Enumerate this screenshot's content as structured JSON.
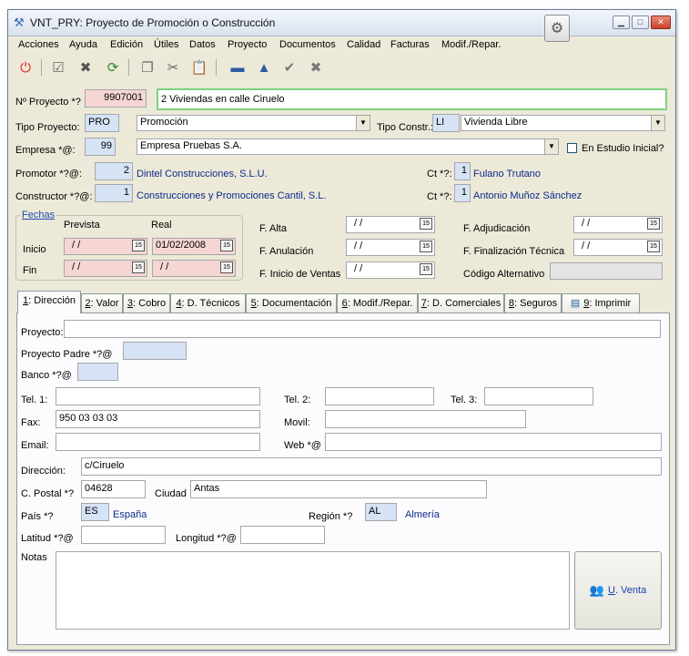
{
  "window": {
    "title": "VNT_PRY: Proyecto de Promoción o Construcción"
  },
  "menu": [
    "Acciones",
    "Ayuda",
    "Edición",
    "Útiles",
    "Datos",
    "Proyecto",
    "Documentos",
    "Calidad",
    "Facturas",
    "Modif./Repar."
  ],
  "header": {
    "nproyecto_label": "Nº Proyecto *?",
    "nproyecto_value": "9907001",
    "nombre_value": "2 Viviendas en calle Ciruelo",
    "tipo_proyecto_label": "Tipo Proyecto:",
    "tipo_proyecto_code": "PRO",
    "tipo_proyecto_desc": "Promoción",
    "tipo_constr_label": "Tipo Constr.:",
    "tipo_constr_code": "LI",
    "tipo_constr_desc": "Vivienda Libre",
    "empresa_label": "Empresa *@:",
    "empresa_code": "99",
    "empresa_desc": "Empresa Pruebas S.A.",
    "estudio_label": "En Estudio Inicial?",
    "promotor_label": "Promotor *?@:",
    "promotor_code": "2",
    "promotor_name": "Dintel Construcciones, S.L.U.",
    "constructor_label": "Constructor *?@:",
    "constructor_code": "1",
    "constructor_name": "Construcciones y Promociones Cantil, S.L.",
    "ct_label_1": "Ct *?:",
    "ct_code_1": "1",
    "ct_name_1": "Fulano Trutano",
    "ct_label_2": "Ct *?:",
    "ct_code_2": "1",
    "ct_name_2": "Antonio Muñoz Sánchez"
  },
  "fechas": {
    "title": "Fechas",
    "prevista_label": "Prevista",
    "real_label": "Real",
    "inicio_label": "Inicio",
    "fin_label": "Fin",
    "inicio_prevista": "/ /",
    "inicio_real": "01/02/2008",
    "fin_prevista": "/ /",
    "fin_real": "/ /",
    "alta_label": "F. Alta",
    "alta_value": "/ /",
    "anulacion_label": "F. Anulación",
    "anulacion_value": "/ /",
    "inicio_ventas_label": "F. Inicio de Ventas",
    "inicio_ventas_value": "/ /",
    "adjudicacion_label": "F. Adjudicación",
    "adjudicacion_value": "/ /",
    "fin_tecnica_label": "F. Finalización Técnica",
    "fin_tecnica_value": "/ /",
    "codigo_alt_label": "Código Alternativo",
    "codigo_alt_value": ""
  },
  "tabs": [
    {
      "key": "1",
      "label": ": Dirección"
    },
    {
      "key": "2",
      "label": ": Valor"
    },
    {
      "key": "3",
      "label": ": Cobro"
    },
    {
      "key": "4",
      "label": ": D. Técnicos"
    },
    {
      "key": "5",
      "label": ": Documentación"
    },
    {
      "key": "6",
      "label": ": Modif./Repar."
    },
    {
      "key": "7",
      "label": ": D. Comerciales"
    },
    {
      "key": "8",
      "label": ": Seguros"
    },
    {
      "key": "9",
      "label": ": Imprimir"
    }
  ],
  "direccion": {
    "proyecto_label": "Proyecto:",
    "proyecto_value": "",
    "padre_label": "Proyecto Padre *?@",
    "banco_label": "Banco *?@",
    "tel1_label": "Tel. 1:",
    "tel1_value": "",
    "tel2_label": "Tel. 2:",
    "tel2_value": "",
    "tel3_label": "Tel. 3:",
    "tel3_value": "",
    "fax_label": "Fax:",
    "fax_value": "950 03 03 03",
    "movil_label": "Movil:",
    "movil_value": "",
    "email_label": "Email:",
    "email_value": "",
    "web_label": "Web *@",
    "web_value": "",
    "direccion_label": "Dirección:",
    "direccion_value": "c/Ciruelo",
    "cpostal_label": "C. Postal *?",
    "cpostal_value": "04628",
    "ciudad_label": "Ciudad",
    "ciudad_value": "Antas",
    "pais_label": "País *?",
    "pais_code": "ES",
    "pais_name": "España",
    "region_label": "Región *?",
    "region_code": "AL",
    "region_name": "Almería",
    "latitud_label": "Latitud *?@",
    "latitud_value": "",
    "longitud_label": "Longitud *?@",
    "longitud_value": "",
    "notas_label": "Notas",
    "uventa_key": "U",
    "uventa_label": ". Venta"
  },
  "colors": {
    "pink_field": "#f5d6d3",
    "blue_field": "#d6e3f5",
    "link_blue": "#0b2a8c",
    "focus_green": "#7ed27e"
  }
}
